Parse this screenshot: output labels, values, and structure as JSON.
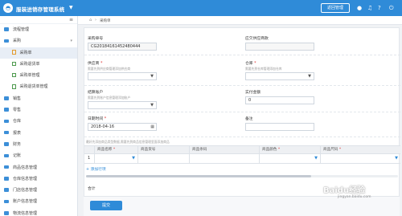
{
  "header": {
    "app_title": "服装进销存管理系统",
    "return_button": "返回管理",
    "logo_glyph": "◓",
    "icons": [
      "user-icon",
      "bell-icon",
      "help-icon",
      "power-icon"
    ]
  },
  "sidebar": {
    "items": [
      {
        "label": "流程管理",
        "level": 1
      },
      {
        "label": "采购",
        "level": 1,
        "expanded": true
      },
      {
        "label": "采购单",
        "level": 2,
        "active": true
      },
      {
        "label": "采购退货单",
        "level": 2
      },
      {
        "label": "采购单管理",
        "level": 2
      },
      {
        "label": "采购退货单管理",
        "level": 2
      },
      {
        "label": "销售",
        "level": 1
      },
      {
        "label": "零售",
        "level": 1
      },
      {
        "label": "仓库",
        "level": 1
      },
      {
        "label": "报表",
        "level": 1
      },
      {
        "label": "财务",
        "level": 1
      },
      {
        "label": "记账",
        "level": 1
      },
      {
        "label": "商品信息管理",
        "level": 1
      },
      {
        "label": "仓库信息管理",
        "level": 1
      },
      {
        "label": "门店信息管理",
        "level": 1
      },
      {
        "label": "账户信息管理",
        "level": 1
      },
      {
        "label": "物流信息管理",
        "level": 1
      }
    ]
  },
  "breadcrumb": {
    "current": "采购单"
  },
  "form": {
    "order_no": {
      "label": "采购单号",
      "value": "CG20184161452480444"
    },
    "supplier_debt": {
      "label": "应欠供应商款"
    },
    "supplier": {
      "label": "供应商",
      "hint": "需要先到供应商管理添加供应商"
    },
    "warehouse": {
      "label": "仓库",
      "hint": "需要先到仓库管理添加仓库"
    },
    "account": {
      "label": "结算账户",
      "hint": "需要先到账户信息管理添加账户"
    },
    "paid_amount": {
      "label": "实付金额",
      "value": "0"
    },
    "date": {
      "label": "日期时间",
      "value": "2018-04-16"
    },
    "remark": {
      "label": "备注"
    },
    "goods_hint": "最好先添加商品类型数据,需要先到商品信息管理里面添加商品",
    "table": {
      "columns": [
        "商品名称",
        "商品货号",
        "商品条码",
        "商品颜色",
        "商品尺码"
      ],
      "rows": [
        {
          "index": "1"
        }
      ]
    },
    "add_row": "+ 添加行项",
    "total_label": "合计",
    "submit": "提交"
  },
  "watermark": {
    "text": "Baidu经验",
    "sub": "jingyan.baidu.com"
  }
}
